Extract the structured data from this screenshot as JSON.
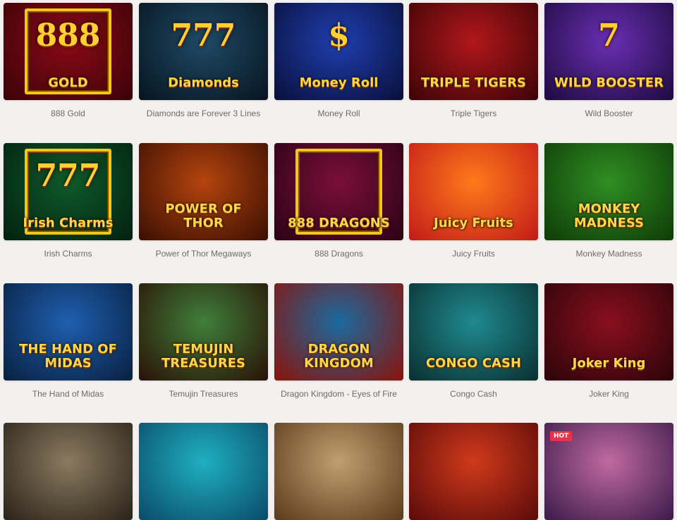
{
  "games": [
    {
      "title": "888 Gold",
      "logo": "GOLD",
      "deco": "888",
      "bg": [
        "#8a0a16",
        "#3a0208"
      ],
      "frame": true
    },
    {
      "title": "Diamonds are Forever 3 Lines",
      "logo": "Diamonds",
      "deco": "777",
      "bg": [
        "#1f4a66",
        "#07141f"
      ],
      "frame": false
    },
    {
      "title": "Money Roll",
      "logo": "Money Roll",
      "deco": "$",
      "bg": [
        "#1e3fb0",
        "#0a0f3a"
      ],
      "frame": false
    },
    {
      "title": "Triple Tigers",
      "logo": "TRIPLE TIGERS",
      "deco": "",
      "bg": [
        "#b0171b",
        "#3c0406"
      ],
      "frame": false
    },
    {
      "title": "Wild Booster",
      "logo": "WILD BOOSTER",
      "deco": "7",
      "bg": [
        "#6a2fb3",
        "#1d0a3f"
      ],
      "frame": false
    },
    {
      "title": "Irish Charms",
      "logo": "Irish Charms",
      "deco": "777",
      "bg": [
        "#0e5a2a",
        "#032010"
      ],
      "frame": true
    },
    {
      "title": "Power of Thor Megaways",
      "logo": "POWER OF THOR",
      "deco": "",
      "bg": [
        "#b5440e",
        "#3a0f02"
      ],
      "frame": false
    },
    {
      "title": "888 Dragons",
      "logo": "888 DRAGONS",
      "deco": "",
      "bg": [
        "#7a0f3a",
        "#2a0214"
      ],
      "frame": true
    },
    {
      "title": "Juicy Fruits",
      "logo": "Juicy Fruits",
      "deco": "",
      "bg": [
        "#ff7a1a",
        "#c21a1a"
      ],
      "frame": false
    },
    {
      "title": "Monkey Madness",
      "logo": "MONKEY MADNESS",
      "deco": "",
      "bg": [
        "#2f8f22",
        "#0f3a08"
      ],
      "frame": false
    },
    {
      "title": "The Hand of Midas",
      "logo": "THE HAND OF MIDAS",
      "deco": "",
      "bg": [
        "#1f5fb0",
        "#082040"
      ],
      "frame": false
    },
    {
      "title": "Temujin Treasures",
      "logo": "TEMUJIN TREASURES",
      "deco": "",
      "bg": [
        "#3f7f3a",
        "#2a1006"
      ],
      "frame": false
    },
    {
      "title": "Dragon Kingdom - Eyes of Fire",
      "logo": "DRAGON KINGDOM",
      "deco": "",
      "bg": [
        "#1a6aa0",
        "#8a1208"
      ],
      "frame": false
    },
    {
      "title": "Congo Cash",
      "logo": "CONGO CASH",
      "deco": "",
      "bg": [
        "#1f8a8f",
        "#0a2f30"
      ],
      "frame": false
    },
    {
      "title": "Joker King",
      "logo": "Joker King",
      "deco": "",
      "bg": [
        "#8a0f1e",
        "#2a0408"
      ],
      "frame": false
    },
    {
      "title": "",
      "logo": "",
      "deco": "",
      "bg": [
        "#8a7a60",
        "#2a2218"
      ],
      "frame": false
    },
    {
      "title": "",
      "logo": "",
      "deco": "",
      "bg": [
        "#1fb0c0",
        "#0a4a6a"
      ],
      "frame": false
    },
    {
      "title": "",
      "logo": "",
      "deco": "",
      "bg": [
        "#c0a070",
        "#5a3a1a"
      ],
      "frame": false
    },
    {
      "title": "",
      "logo": "",
      "deco": "",
      "bg": [
        "#d03a1a",
        "#5a0a0a"
      ],
      "frame": false
    },
    {
      "title": "",
      "logo": "",
      "deco": "",
      "bg": [
        "#c06aa0",
        "#3a1a4a"
      ],
      "frame": false,
      "badge": "HOT"
    }
  ]
}
